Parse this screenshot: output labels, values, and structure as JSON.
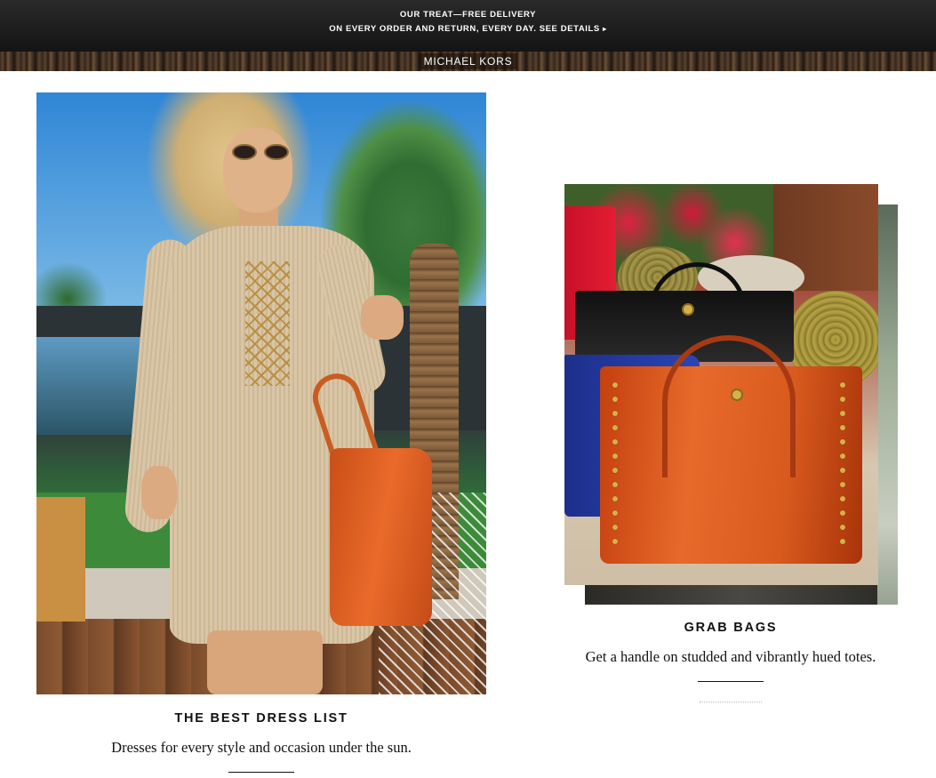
{
  "promo": {
    "line1": "OUR TREAT—FREE DELIVERY",
    "line2_text": "ON EVERY ORDER AND RETURN, EVERY DAY.",
    "line2_link": "SEE DETAILS"
  },
  "brand": {
    "name": "MICHAEL KORS"
  },
  "features": {
    "dress": {
      "title": "THE BEST DRESS LIST",
      "text": "Dresses for every style and occasion under the sun."
    },
    "bags": {
      "title": "GRAB BAGS",
      "text": "Get a handle on studded and vibrantly hued totes."
    }
  },
  "icons": {
    "see_details_chevron": "chevron-right-icon"
  },
  "colors": {
    "promo_bg": "#1a1a1a",
    "text": "#111111",
    "accent_orange": "#e86a2a"
  }
}
